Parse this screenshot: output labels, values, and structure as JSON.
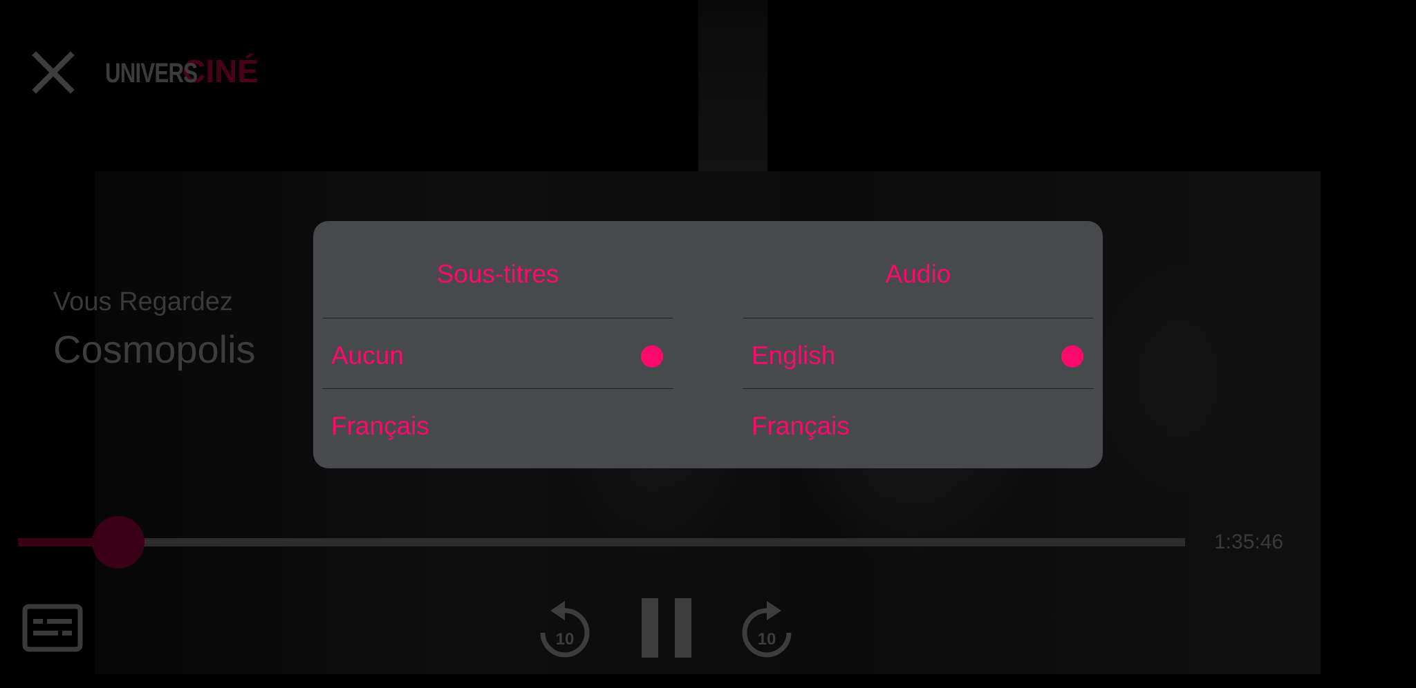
{
  "header": {
    "brand_part1": "UNIVERS",
    "brand_part2": "CINÉ"
  },
  "now_playing": {
    "label": "Vous Regardez",
    "title": "Cosmopolis"
  },
  "playback": {
    "total_time": "1:35:46",
    "progress_fraction": 0.086,
    "rewind_seconds": "10",
    "forward_seconds": "10"
  },
  "dialog": {
    "subtitles": {
      "heading": "Sous-titres",
      "options": [
        {
          "label": "Aucun",
          "selected": true
        },
        {
          "label": "Français",
          "selected": false
        }
      ]
    },
    "audio": {
      "heading": "Audio",
      "options": [
        {
          "label": "English",
          "selected": true
        },
        {
          "label": "Français",
          "selected": false
        }
      ]
    }
  },
  "icons": {
    "close": "close-icon",
    "subtitles": "subtitles-icon",
    "rewind": "rewind-10-icon",
    "pause": "pause-icon",
    "forward": "forward-10-icon"
  },
  "colors": {
    "accent": "#ff0a6c",
    "dialog_bg": "#48494d",
    "dim_accent": "#3a0016",
    "background": "#000000"
  }
}
